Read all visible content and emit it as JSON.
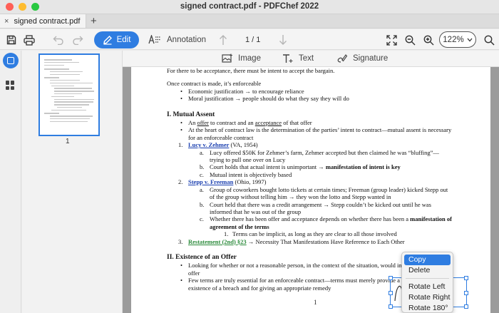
{
  "window": {
    "title": "signed contract.pdf - PDFChef 2022",
    "colors": {
      "close": "#ff5f57",
      "minimize": "#febc2e",
      "zoom": "#28c840",
      "accent": "#2f7de1"
    }
  },
  "tabs": [
    {
      "label": "signed contract.pdf",
      "close": "×"
    }
  ],
  "tab_add": "+",
  "toolbar": {
    "edit_label": "Edit",
    "annotation_label": "Annotation",
    "page_indicator": "1 / 1",
    "zoom_value": "122%",
    "icons": [
      "save-icon",
      "print-icon",
      "undo-icon",
      "redo-icon",
      "edit-pencil-icon",
      "annotation-icon",
      "arrow-up-icon",
      "arrow-down-icon",
      "fit-page-icon",
      "zoom-out-icon",
      "zoom-in-icon",
      "chevron-down-icon",
      "search-icon"
    ]
  },
  "subtoolbar": {
    "image_label": "Image",
    "text_label": "Text",
    "signature_label": "Signature"
  },
  "thumbnails": [
    {
      "page_number": "1"
    }
  ],
  "document": {
    "line_bargain": "For there to be acceptance, there must be intent to accept the bargain.",
    "line_once": "Once contract is made, it’s enforceable",
    "bullets_top": [
      "Economic justification → to encourage reliance",
      "Moral justification → people should do what they say they will do"
    ],
    "section1_heading": "I. Mutual Assent",
    "s1_b1_pre": "An ",
    "s1_b1_offer": "offer",
    "s1_b1_mid": " to contract and an ",
    "s1_b1_acceptance": "acceptance",
    "s1_b1_post": " of that offer",
    "s1_b2": "At the heart of contract law is the determination of the parties’ intent to contract—mutual assent is necessary for an enforceable contract",
    "case1_num": "1.",
    "case1_name": "Lucy v. Zehmer",
    "case1_cite": " (VA, 1954)",
    "case1_items": [
      {
        "n": "a.",
        "text": "Lucy offered $50K for Zehmer’s farm, Zehmer accepted but then claimed he was “bluffing”—trying to pull one over on Lucy"
      },
      {
        "n": "b.",
        "pre": "Court holds that actual intent is unimportant → ",
        "bold": "manifestation of intent is key"
      },
      {
        "n": "c.",
        "text": "Mutual intent is objectively based"
      }
    ],
    "case2_num": "2.",
    "case2_name": "Stepp v. Freeman",
    "case2_cite": " (Ohio, 1997)",
    "case2_items": [
      {
        "n": "a.",
        "text": "Group of coworkers bought lotto tickets at certain times; Freeman (group leader) kicked Stepp out of the group without telling him → they won the lotto and Stepp wanted in"
      },
      {
        "n": "b.",
        "text": "Court held that there was a credit arrangement → Stepp couldn’t be kicked out until he was informed that he was out of the group"
      },
      {
        "n": "c.",
        "pre": "Whether there has been offer and acceptance depends on whether there has been a ",
        "bold": "manifestation of agreement of the terms"
      }
    ],
    "case2_sub_num": "1.",
    "case2_sub": "Terms can be implicit, as long as they are clear to all those involved",
    "item3_num": "3.",
    "item3_name": "Restatement (2nd) §23",
    "item3_post": " → Necessity That Manifestations Have Reference to Each Other",
    "section2_heading": "II. Existence of an Offer",
    "s2_bullets": [
      "Looking for whether or not a reasonable person, in the context of the situation, would in statement as an offer",
      "Few terms are truly essential for an enforceable contract—terms must merely provide a b determining the existence of a breach and for giving an appropriate remedy"
    ],
    "page_number": "1"
  },
  "context_menu": {
    "items": [
      "Copy",
      "Delete",
      "Rotate Left",
      "Rotate Right",
      "Rotate 180°"
    ],
    "active": "Copy"
  }
}
